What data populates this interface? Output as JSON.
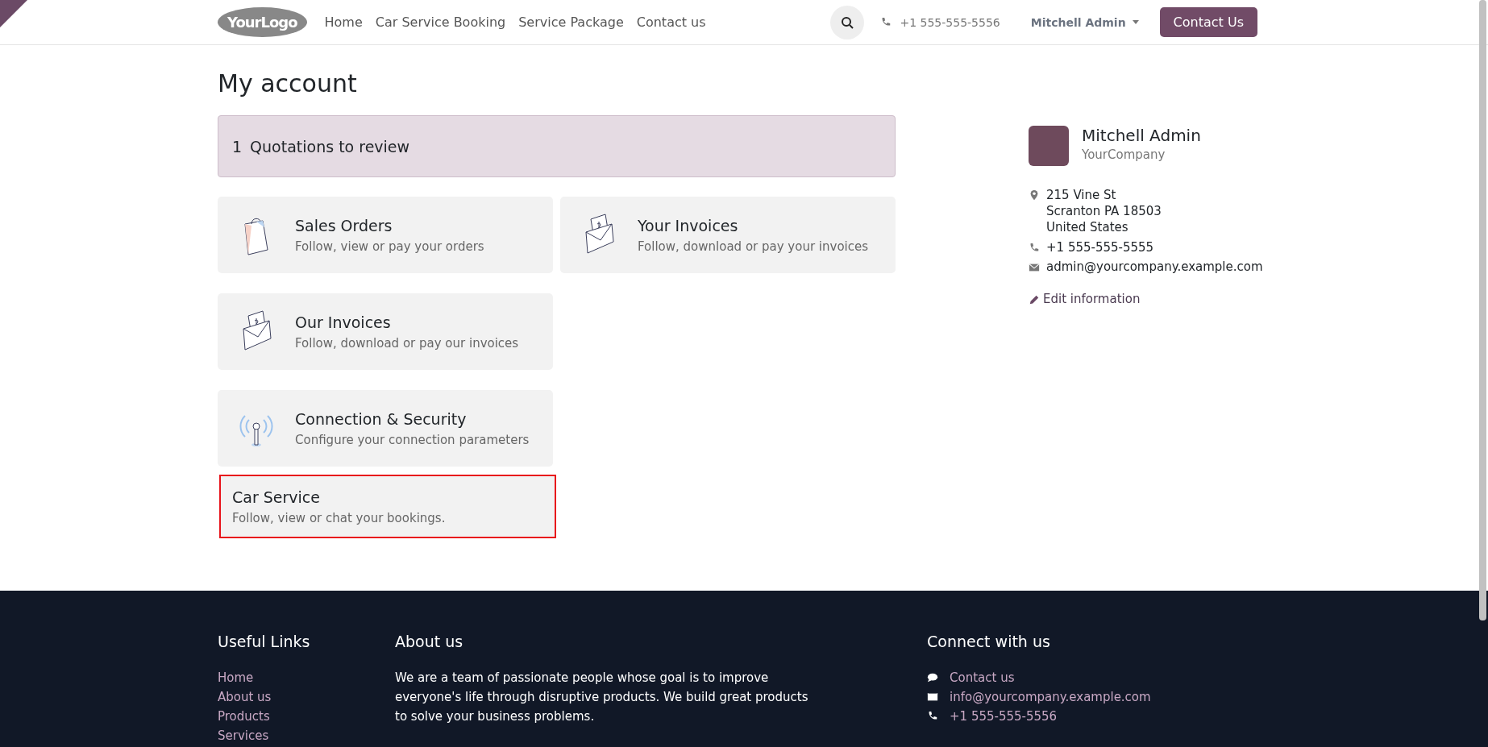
{
  "header": {
    "logo": "YourLogo",
    "nav": [
      {
        "label": "Home"
      },
      {
        "label": "Car Service Booking"
      },
      {
        "label": "Service Package"
      },
      {
        "label": "Contact us"
      }
    ],
    "phone": "+1 555-555-5556",
    "user": "Mitchell Admin",
    "cta": "Contact Us"
  },
  "title": "My account",
  "alert": {
    "count": "1",
    "text": "Quotations to review"
  },
  "cards": [
    {
      "kind": "bag",
      "title": "Sales Orders",
      "text": "Follow, view or pay your orders",
      "highlighted": false
    },
    {
      "kind": "envelope",
      "title": "Your Invoices",
      "text": "Follow, download or pay your invoices",
      "highlighted": false
    },
    {
      "kind": "envelope",
      "title": "Our Invoices",
      "text": "Follow, download or pay our invoices",
      "highlighted": false
    },
    {
      "kind": "antenna",
      "title": "Connection & Security",
      "text": "Configure your connection parameters",
      "highlighted": false
    },
    {
      "kind": "plain",
      "title": "Car Service",
      "text": "Follow, view or chat your bookings.",
      "highlighted": true
    }
  ],
  "profile": {
    "name": "Mitchell Admin",
    "company": "YourCompany",
    "address": [
      "215 Vine St",
      "Scranton PA 18503",
      "United States"
    ],
    "phone": "+1 555-555-5555",
    "email": "admin@yourcompany.example.com",
    "edit": "Edit information"
  },
  "footer": {
    "links_title": "Useful Links",
    "links": [
      "Home",
      "About us",
      "Products",
      "Services"
    ],
    "about_title": "About us",
    "about": "We are a team of passionate people whose goal is to improve everyone's life through disruptive products. We build great products to solve your business problems.",
    "connect_title": "Connect with us",
    "connect": [
      {
        "kind": "chat",
        "text": "Contact us"
      },
      {
        "kind": "mail",
        "text": "info@yourcompany.example.com"
      },
      {
        "kind": "phone",
        "text": "+1 555-555-5556"
      }
    ]
  }
}
